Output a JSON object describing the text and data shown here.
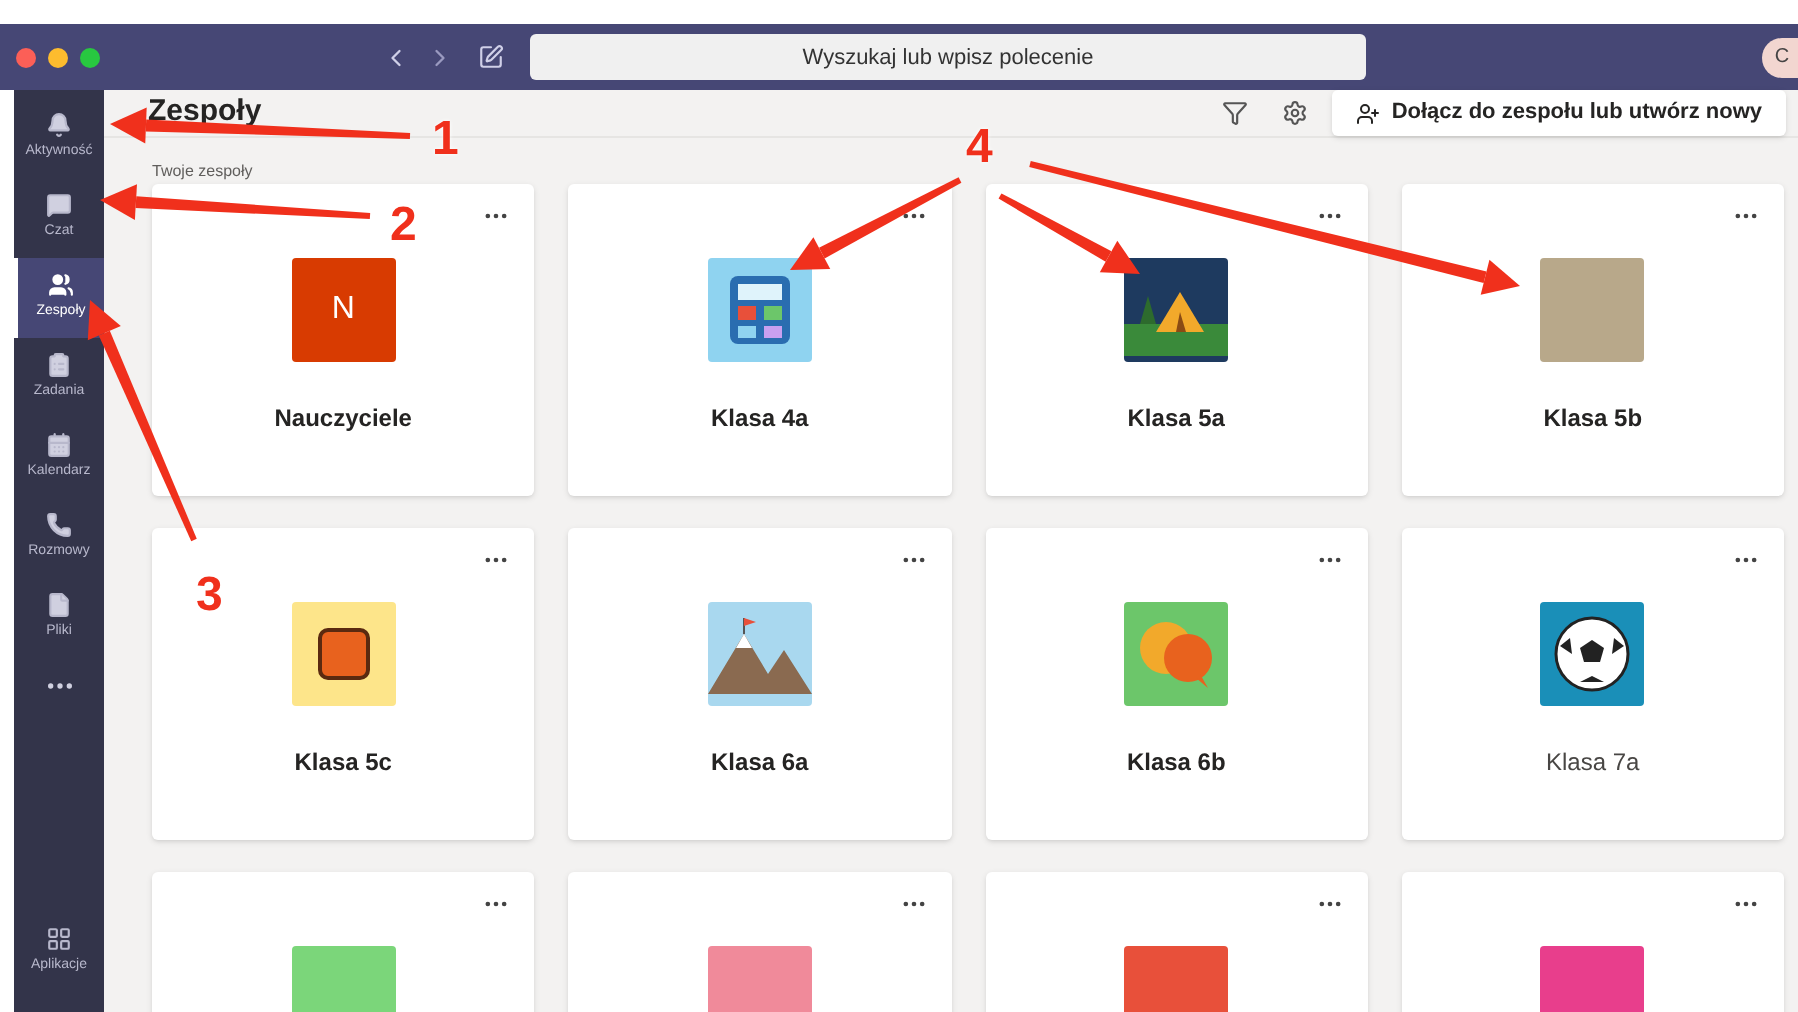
{
  "titlebar": {
    "search": {
      "placeholder": "Wyszukaj lub wpisz polecenie"
    },
    "avatar": "C"
  },
  "sidebar": {
    "items": [
      {
        "label": "Aktywność",
        "selected": false
      },
      {
        "label": "Czat",
        "selected": false
      },
      {
        "label": "Zespoły",
        "selected": true
      },
      {
        "label": "Zadania",
        "selected": false
      },
      {
        "label": "Kalendarz",
        "selected": false
      },
      {
        "label": "Rozmowy",
        "selected": false
      },
      {
        "label": "Pliki",
        "selected": false
      }
    ],
    "bottom": {
      "label": "Aplikacje"
    }
  },
  "header": {
    "title": "Zespoły",
    "join_button": "Dołącz do zespołu lub utwórz nowy"
  },
  "section_label": "Twoje zespoły",
  "teams": [
    {
      "name": "Nauczyciele",
      "kind": "letter",
      "letter": "N",
      "color": "#d83b01",
      "bold": true
    },
    {
      "name": "Klasa 4a",
      "kind": "calculator",
      "color": "#8fd3f0",
      "bold": true
    },
    {
      "name": "Klasa 5a",
      "kind": "tent",
      "color": "#1e3a5f",
      "bold": true
    },
    {
      "name": "Klasa 5b",
      "kind": "photo",
      "color": "#b8a88a",
      "bold": true
    },
    {
      "name": "Klasa 5c",
      "kind": "square",
      "color": "#fde58a",
      "bold": true
    },
    {
      "name": "Klasa 6a",
      "kind": "mountain",
      "color": "#a9d8ef",
      "bold": true
    },
    {
      "name": "Klasa 6b",
      "kind": "bubbles",
      "color": "#6cc66a",
      "bold": true
    },
    {
      "name": "Klasa 7a",
      "kind": "ball",
      "color": "#1a8fb8",
      "bold": false
    },
    {
      "kind": "plain",
      "color": "#7bd67a"
    },
    {
      "kind": "plain",
      "color": "#f08a9a"
    },
    {
      "kind": "plain",
      "color": "#e8503a"
    },
    {
      "kind": "plain",
      "color": "#e83e8c"
    }
  ],
  "annotations": [
    {
      "label": "1"
    },
    {
      "label": "2"
    },
    {
      "label": "3"
    },
    {
      "label": "4"
    }
  ]
}
